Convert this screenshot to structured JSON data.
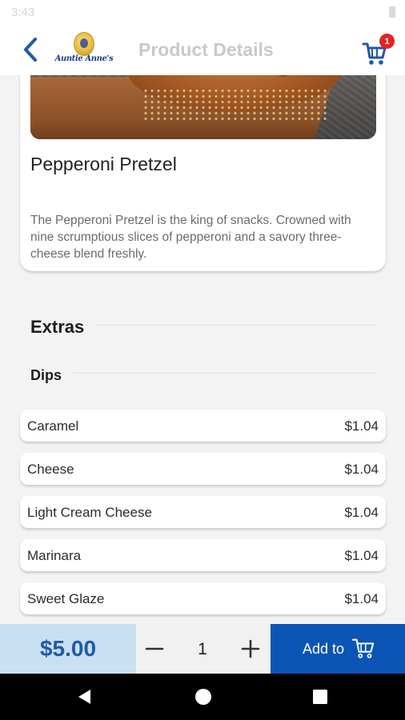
{
  "status_bar": {
    "time": "3:43"
  },
  "header": {
    "title": "Product Details",
    "logo_text": "Auntie Anne's",
    "cart_count": "1",
    "back_icon": "chevron-left-icon",
    "cart_icon": "cart-icon"
  },
  "product": {
    "name": "Pepperoni Pretzel",
    "description": "The Pepperoni Pretzel is the king of snacks. Crowned with nine scrumptious slices of pepperoni and a savory three-cheese blend freshly."
  },
  "extras": {
    "heading": "Extras",
    "dips_heading": "Dips",
    "dips": [
      {
        "label": "Caramel",
        "price": "$1.04"
      },
      {
        "label": "Cheese",
        "price": "$1.04"
      },
      {
        "label": "Light Cream Cheese",
        "price": "$1.04"
      },
      {
        "label": "Marinara",
        "price": "$1.04"
      },
      {
        "label": "Sweet Glaze",
        "price": "$1.04"
      }
    ]
  },
  "order_bar": {
    "price": "$5.00",
    "quantity": "1",
    "add_label": "Add to"
  },
  "colors": {
    "brand_blue": "#0a55b5",
    "price_bg": "#c9dff2",
    "badge_red": "#e02424"
  }
}
